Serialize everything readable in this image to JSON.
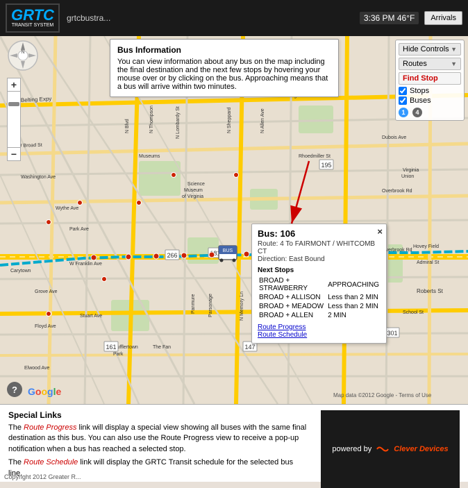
{
  "header": {
    "logo_grtc": "GRTC",
    "logo_subtitle": "TRANSIT SYSTEM",
    "url": "grtcbustra...",
    "datetime": "3:36 PM  46°F",
    "arrivals_btn": "Arrivals"
  },
  "controls": {
    "hide_controls": "Hide Controls",
    "routes": "Routes",
    "find_stop": "Find Stop",
    "stops_label": "Stops",
    "buses_label": "Buses",
    "legend": [
      {
        "number": "1",
        "color": "#3399ff"
      },
      {
        "number": "4",
        "color": "#666666"
      }
    ]
  },
  "bus_tooltip": {
    "bus_number": "Bus: 106",
    "route": "Route: 4 To FAIRMONT / WHITCOMB CT",
    "direction": "Direction: East Bound",
    "next_stops_title": "Next Stops",
    "stops": [
      {
        "location": "BROAD + STRAWBERRY",
        "time": "APPROACHING"
      },
      {
        "location": "BROAD + ALLISON",
        "time": "Less than 2 MIN"
      },
      {
        "location": "BROAD + MEADOW",
        "time": "Less than 2 MIN"
      },
      {
        "location": "BROAD + ALLEN",
        "time": "2 MIN"
      }
    ],
    "route_progress_link": "Route Progress",
    "route_schedule_link": "Route Schedule",
    "close": "×"
  },
  "bus_info_callout": {
    "title": "Bus Information",
    "text": "You can view information about any bus on the map including the final destination and the next few stops by hovering your mouse over or by clicking on the bus. Approaching means that a bus will arrive within two minutes."
  },
  "special_links": {
    "title": "Special Links",
    "route_progress_text_1": "The Route Progress link will display a special view showing all buses with the same final destination as this bus. You can also use the Route Progress view to receive a pop-up notification when a bus has reached a selected stop.",
    "route_schedule_text": "The Route Schedule link will display the GRTC Transit schedule for the selected bus line.",
    "route_progress_link": "Route Progress",
    "route_schedule_link": "Route Schedule"
  },
  "powered_by": {
    "text": "powered by",
    "brand": "Clever Devices"
  },
  "copyright": "Copyright 2012 Greater R..."
}
